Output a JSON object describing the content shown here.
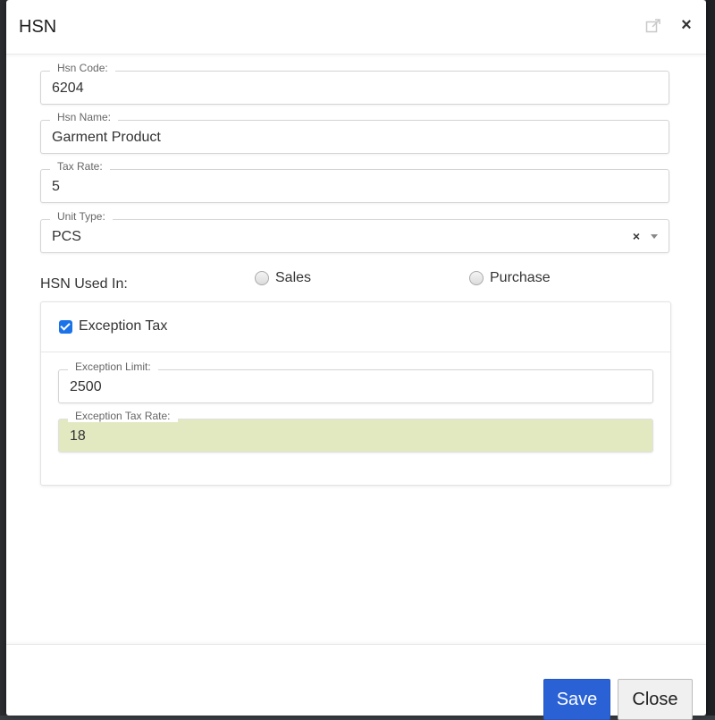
{
  "modal": {
    "title": "HSN",
    "icons": {
      "popout": "external-link-icon",
      "close": "close-icon"
    },
    "close_glyph": "×"
  },
  "form": {
    "hsn_code": {
      "label": "Hsn Code:",
      "value": "6204"
    },
    "hsn_name": {
      "label": "Hsn Name:",
      "value": "Garment Product"
    },
    "tax_rate": {
      "label": "Tax Rate:",
      "value": "5"
    },
    "unit_type": {
      "label": "Unit Type:",
      "value": "PCS",
      "clear_glyph": "×"
    },
    "used_in": {
      "label": "HSN Used In:",
      "options": [
        {
          "label": "Sales",
          "selected": false
        },
        {
          "label": "Purchase",
          "selected": false
        }
      ]
    }
  },
  "exception": {
    "checkbox_label": "Exception Tax",
    "checked": true,
    "limit": {
      "label": "Exception Limit:",
      "value": "2500"
    },
    "rate": {
      "label": "Exception Tax Rate:",
      "value": "18"
    }
  },
  "footer": {
    "save_label": "Save",
    "close_label": "Close"
  },
  "colors": {
    "primary": "#2a62d6",
    "checkbox": "#1a73e8",
    "highlight": "#e2e9c1"
  }
}
